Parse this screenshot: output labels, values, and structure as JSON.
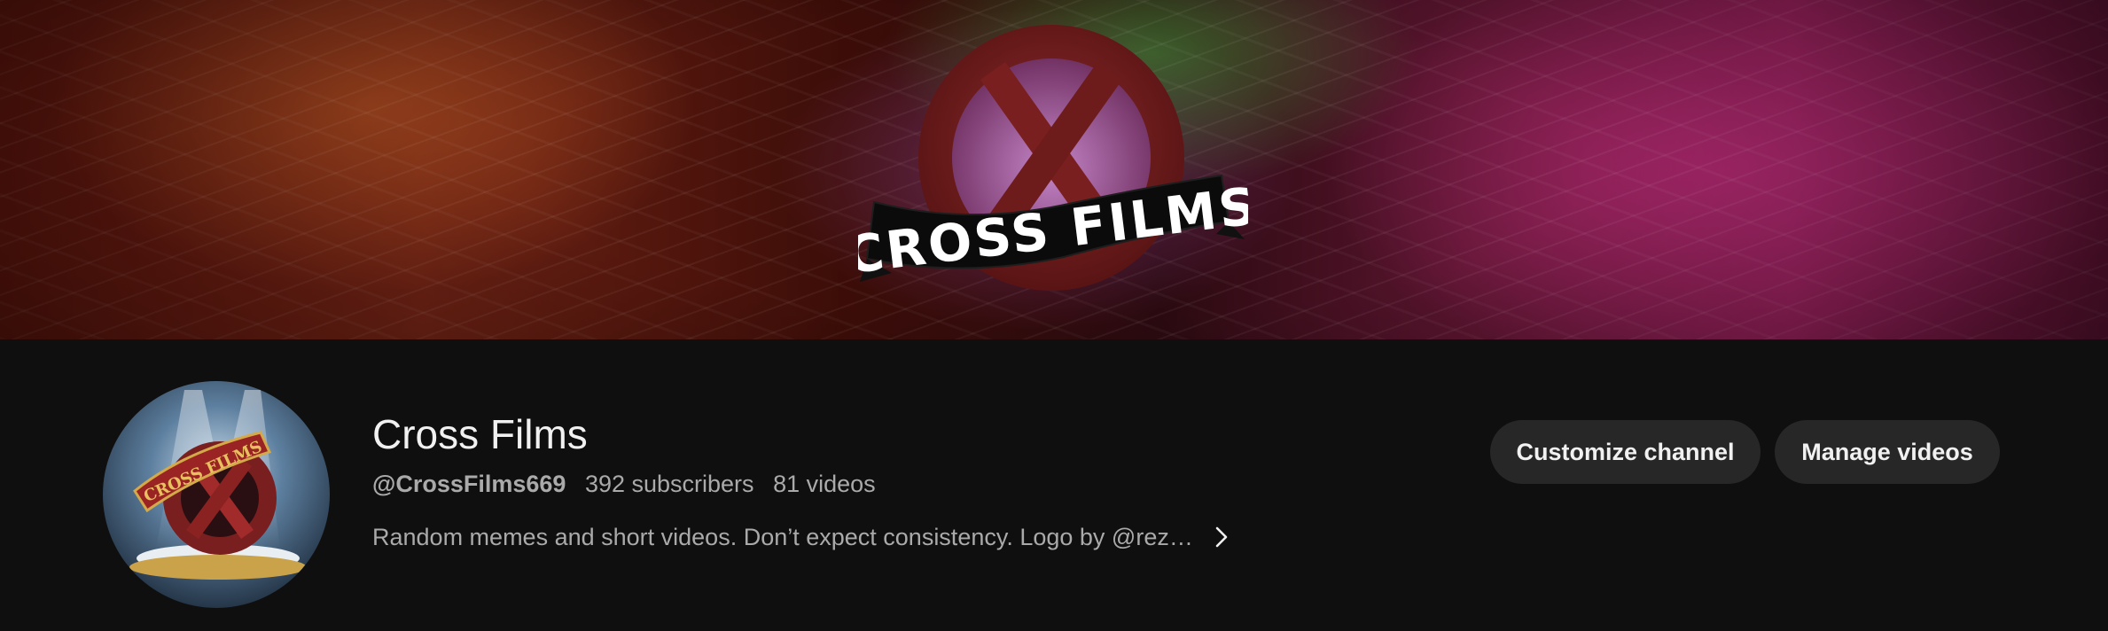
{
  "banner": {
    "logo_text": "CROSS FILMS"
  },
  "avatar": {
    "logo_text": "CROSS FILMS"
  },
  "channel": {
    "name": "Cross Films",
    "handle": "@CrossFilms669",
    "subscribers": "392 subscribers",
    "videos": "81 videos",
    "description": "Random memes and short videos. Don’t expect consistency. Logo by @rez…"
  },
  "actions": {
    "customize_label": "Customize channel",
    "manage_label": "Manage videos"
  },
  "icons": {
    "description_expand": "chevron-right-icon"
  },
  "colors": {
    "page_background": "#0f0f0f",
    "button_background": "#272727",
    "primary_text": "#f1f1f1",
    "secondary_text": "#aaaaaa",
    "logo_red": "#7a1f1f"
  }
}
